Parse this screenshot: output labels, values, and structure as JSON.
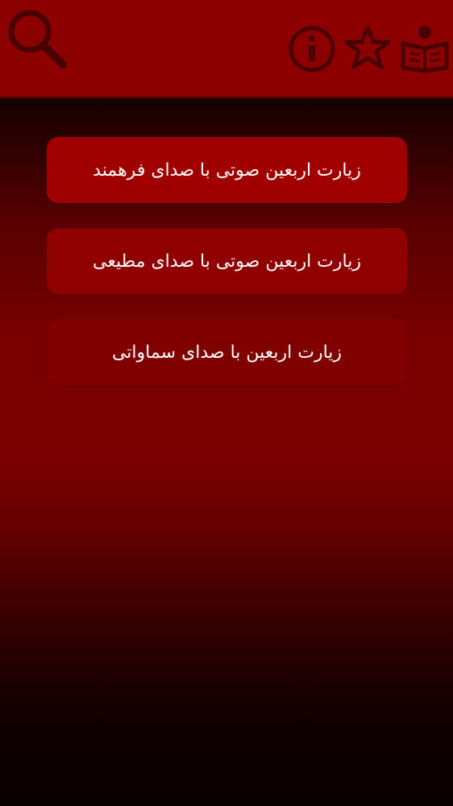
{
  "theme": {
    "topbar_color": "#8c0000",
    "icon_color": "#4a0000",
    "button_color": "#a00000",
    "text_color": "#ffffff"
  },
  "toolbar": {
    "icons": [
      "search-icon",
      "info-icon",
      "star-icon",
      "book-reader-icon"
    ]
  },
  "menu": {
    "items": [
      {
        "label": "زیارت اربعین صوتی با صدای فرهمند"
      },
      {
        "label": "زیارت اربعین صوتی با صدای مطیعی"
      },
      {
        "label": "زیارت اربعین با صدای سماواتی"
      }
    ]
  }
}
